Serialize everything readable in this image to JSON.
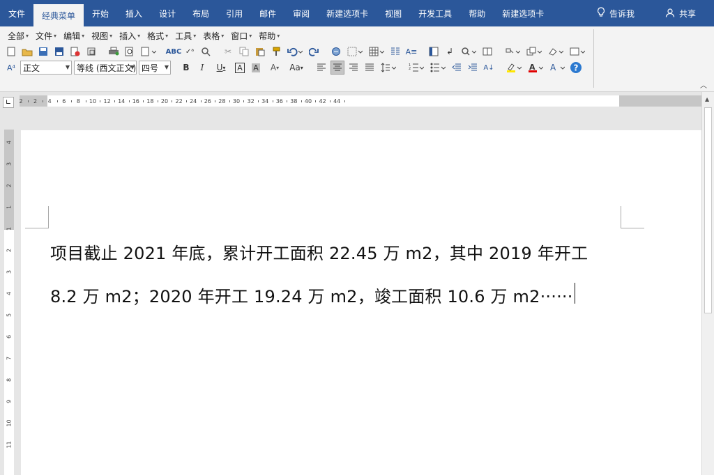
{
  "ribbon_tabs": [
    "文件",
    "经典菜单",
    "开始",
    "插入",
    "设计",
    "布局",
    "引用",
    "邮件",
    "审阅",
    "新建选项卡",
    "视图",
    "开发工具",
    "帮助",
    "新建选项卡"
  ],
  "active_tab": "经典菜单",
  "tell_me": "告诉我",
  "share": "共享",
  "classic_menus": [
    "全部",
    "文件",
    "编辑",
    "视图",
    "插入",
    "格式",
    "工具",
    "表格",
    "窗口",
    "帮助"
  ],
  "style_combo": "正文",
  "font_combo": "等线 (西文正文)",
  "size_combo": "四号",
  "ruler_numbers": [
    "2",
    "2",
    "4",
    "6",
    "8",
    "10",
    "12",
    "14",
    "16",
    "18",
    "20",
    "22",
    "24",
    "26",
    "28",
    "30",
    "32",
    "34",
    "36",
    "38",
    "40",
    "42",
    "44"
  ],
  "vruler_numbers": [
    "4",
    "3",
    "2",
    "1",
    "1",
    "2",
    "3",
    "4",
    "5",
    "6",
    "7",
    "8",
    "9",
    "10",
    "11"
  ],
  "document": {
    "line1": "项目截止 2021 年底，累计开工面积 22.45 万 m2，其中 2019 年开工",
    "line2": "8.2 万 m2；2020 年开工 19.24 万 m2，竣工面积 10.6 万 m2······"
  },
  "icons": {
    "tell_me": "lightbulb-icon",
    "share": "person-icon",
    "help": "help-circle-icon"
  },
  "colors": {
    "ribbon_blue": "#2b579a",
    "highlight_yellow": "#ffe600",
    "font_red": "#e00000"
  }
}
